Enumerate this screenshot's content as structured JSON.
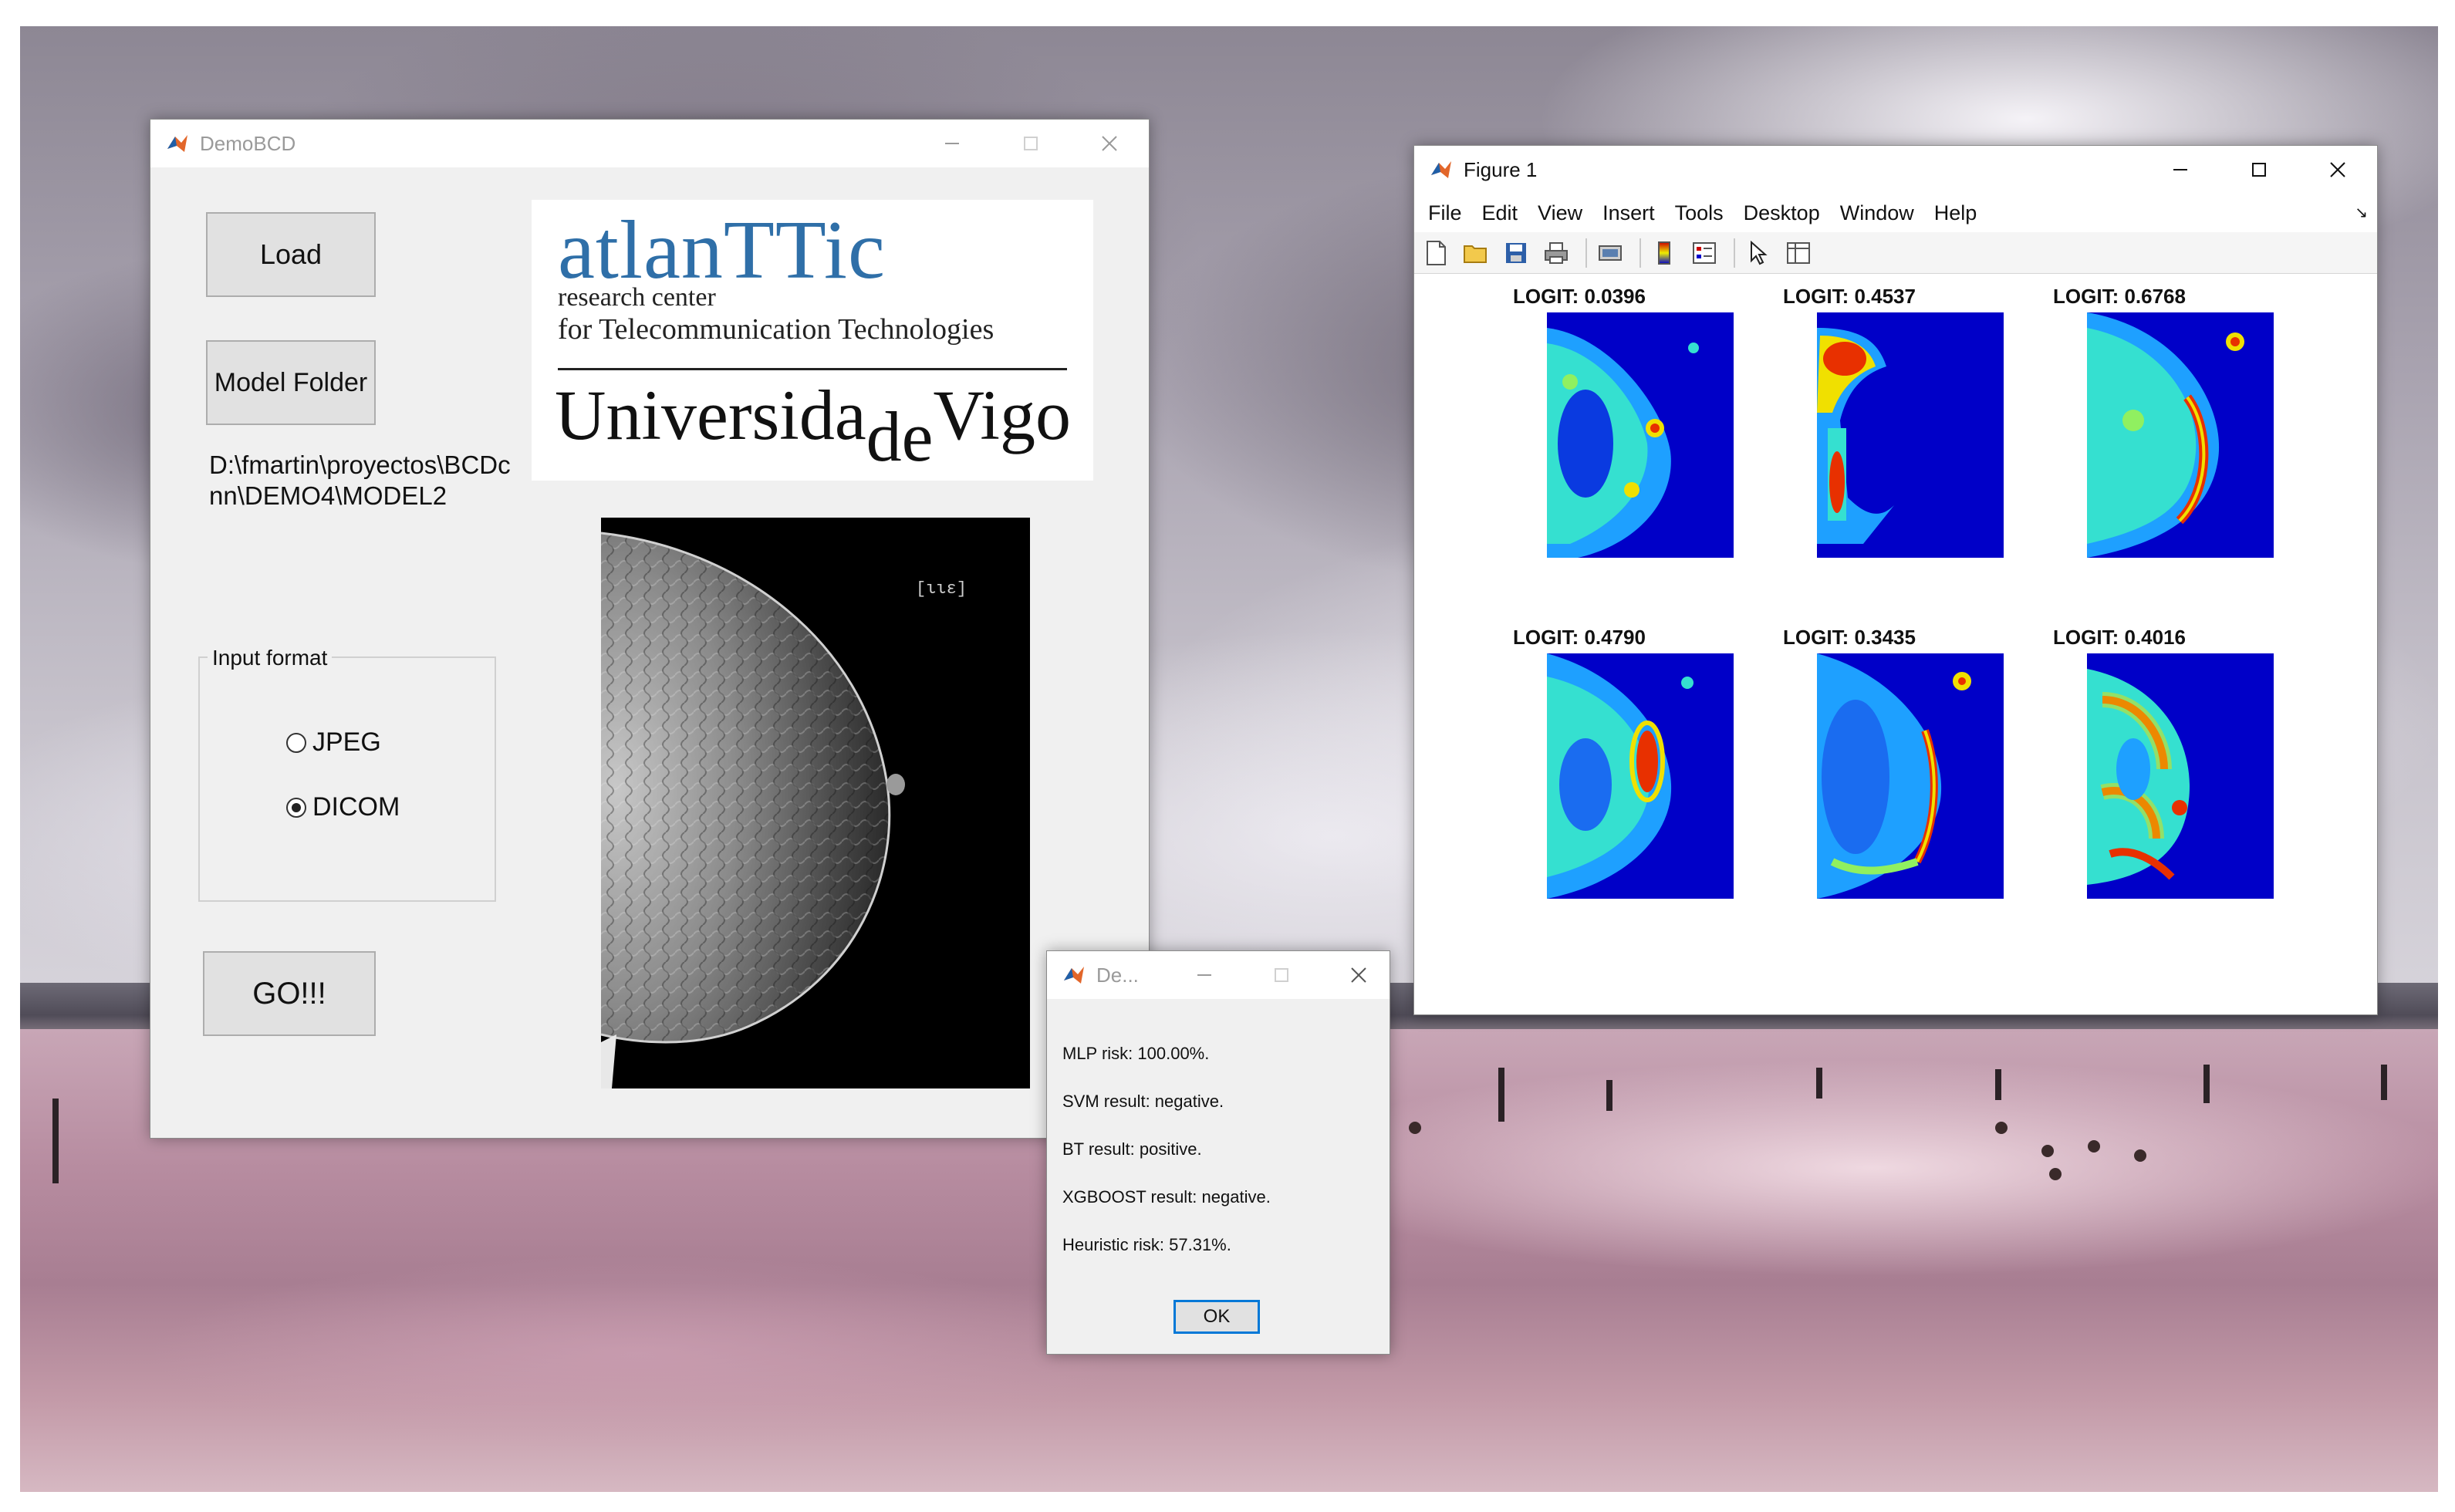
{
  "demo_window": {
    "title": "DemoBCD",
    "load_label": "Load",
    "model_folder_label": "Model Folder",
    "model_path": "D:\\fmartin\\proyectos\\BCDcnn\\DEMO4\\MODEL2",
    "input_format": {
      "legend": "Input format",
      "options": [
        "JPEG",
        "DICOM"
      ],
      "selected": "DICOM"
    },
    "go_label": "GO!!!",
    "logo": {
      "main": "atlanTTic",
      "line1": "research center",
      "line2": "for Telecommunication Technologies",
      "university_a": "Universida",
      "university_de": "de",
      "university_b": "Vigo"
    },
    "mammogram_label": "[ιιε]"
  },
  "figure_window": {
    "title": "Figure 1",
    "menus": [
      "File",
      "Edit",
      "View",
      "Insert",
      "Tools",
      "Desktop",
      "Window",
      "Help"
    ],
    "toolbar_icons": [
      "new-figure-icon",
      "open-file-icon",
      "save-icon",
      "print-icon",
      "print-preview-icon",
      "colorbar-icon",
      "legend-icon",
      "pointer-icon",
      "property-editor-icon"
    ],
    "heatmaps": [
      {
        "title": "LOGIT: 0.0396"
      },
      {
        "title": "LOGIT: 0.4537"
      },
      {
        "title": "LOGIT: 0.6768"
      },
      {
        "title": "LOGIT: 0.4790"
      },
      {
        "title": "LOGIT: 0.3435"
      },
      {
        "title": "LOGIT: 0.4016"
      }
    ]
  },
  "result_dialog": {
    "title": "De...",
    "lines": [
      "MLP risk: 100.00%.",
      "SVM result: negative.",
      "BT result: positive.",
      "XGBOOST result: negative.",
      "Heuristic risk: 57.31%."
    ],
    "ok_label": "OK"
  },
  "colors": {
    "accent": "#0078d7",
    "logo_blue": "#2f6fa8",
    "heatmap_background": "#0000c8"
  }
}
